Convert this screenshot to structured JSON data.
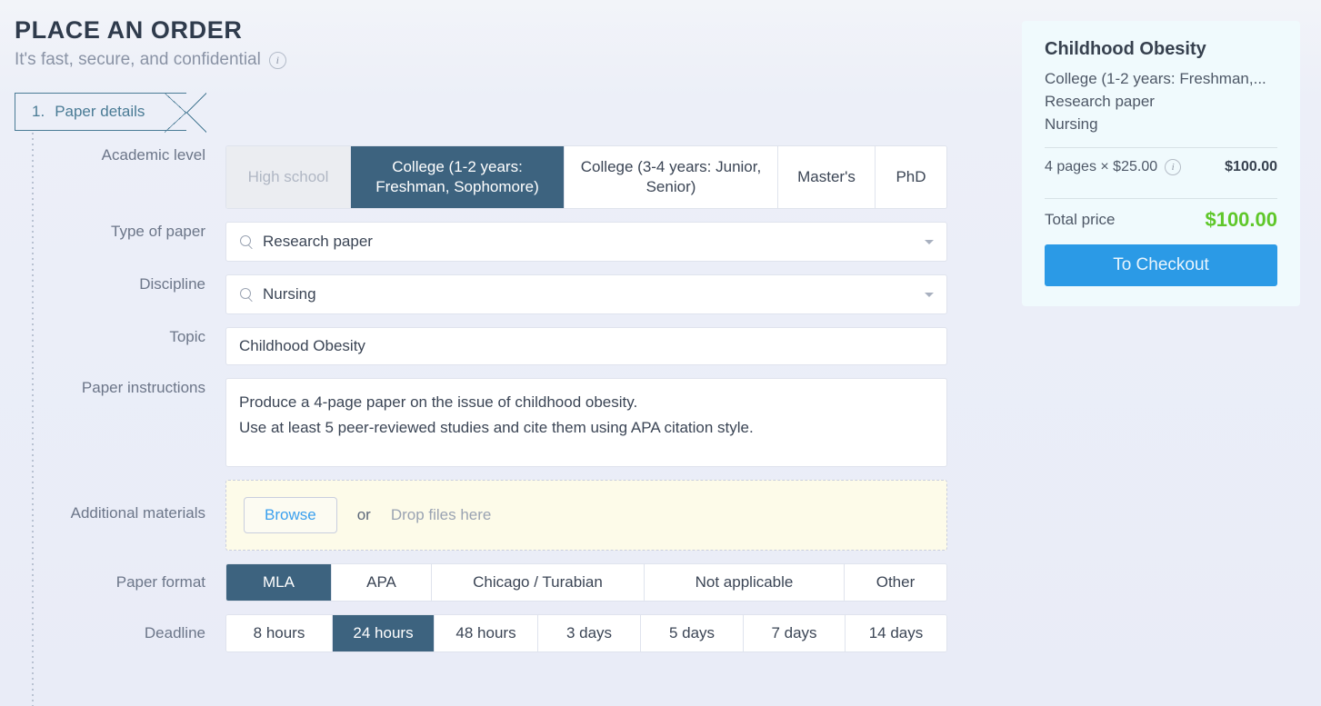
{
  "header": {
    "title": "PLACE AN ORDER",
    "subtitle": "It's fast, secure, and confidential",
    "info_icon": "info-icon",
    "info_glyph": "i"
  },
  "steps": [
    {
      "number": "1.",
      "label": "Paper details"
    }
  ],
  "form": {
    "academic_level": {
      "label": "Academic level",
      "options": [
        {
          "label": "High school",
          "state": "disabled"
        },
        {
          "label": "College (1-2 years: Freshman, Sophomore)",
          "state": "selected"
        },
        {
          "label": "College (3-4 years: Junior, Senior)",
          "state": "normal"
        },
        {
          "label": "Master's",
          "state": "normal"
        },
        {
          "label": "PhD",
          "state": "normal"
        }
      ]
    },
    "type_of_paper": {
      "label": "Type of paper",
      "value": "Research paper",
      "icon": "search-icon",
      "caret": "chevron-down-icon"
    },
    "discipline": {
      "label": "Discipline",
      "value": "Nursing",
      "icon": "search-icon",
      "caret": "chevron-down-icon"
    },
    "topic": {
      "label": "Topic",
      "value": "Childhood Obesity",
      "placeholder": "Topic"
    },
    "paper_instructions": {
      "label": "Paper instructions",
      "value": "Produce a 4-page paper on the issue of childhood obesity.\nUse at least 5 peer-reviewed studies and cite them using APA citation style.",
      "placeholder": "Paper instructions"
    },
    "additional_materials": {
      "label": "Additional materials",
      "browse_label": "Browse",
      "or_label": "or",
      "drop_hint": "Drop files here"
    },
    "paper_format": {
      "label": "Paper format",
      "options": [
        {
          "label": "MLA",
          "state": "selected"
        },
        {
          "label": "APA",
          "state": "normal"
        },
        {
          "label": "Chicago / Turabian",
          "state": "normal"
        },
        {
          "label": "Not applicable",
          "state": "normal"
        },
        {
          "label": "Other",
          "state": "normal"
        }
      ]
    },
    "deadline": {
      "label": "Deadline",
      "options": [
        {
          "label": "8 hours",
          "state": "normal"
        },
        {
          "label": "24 hours",
          "state": "selected"
        },
        {
          "label": "48 hours",
          "state": "normal"
        },
        {
          "label": "3 days",
          "state": "normal"
        },
        {
          "label": "5 days",
          "state": "normal"
        },
        {
          "label": "7 days",
          "state": "normal"
        },
        {
          "label": "14 days",
          "state": "normal"
        }
      ]
    }
  },
  "summary": {
    "title": "Childhood Obesity",
    "meta_level": "College (1-2 years: Freshman,...",
    "meta_type": "Research paper",
    "meta_discipline": "Nursing",
    "price_line_label": "4 pages × $25.00",
    "price_line_info_glyph": "i",
    "price_line_amount": "$100.00",
    "total_label": "Total price",
    "total_amount": "$100.00",
    "checkout_label": "To Checkout"
  },
  "colors": {
    "page_background": "#e9ecf7",
    "selected_segment": "#3d637f",
    "accent_blue": "#2b9ae6",
    "link_blue": "#3ba0ee",
    "total_green": "#5fc72a",
    "step_outline": "#4a7b95",
    "summary_card": "#f0fafd",
    "dropzone_background": "#fdfbe9"
  }
}
